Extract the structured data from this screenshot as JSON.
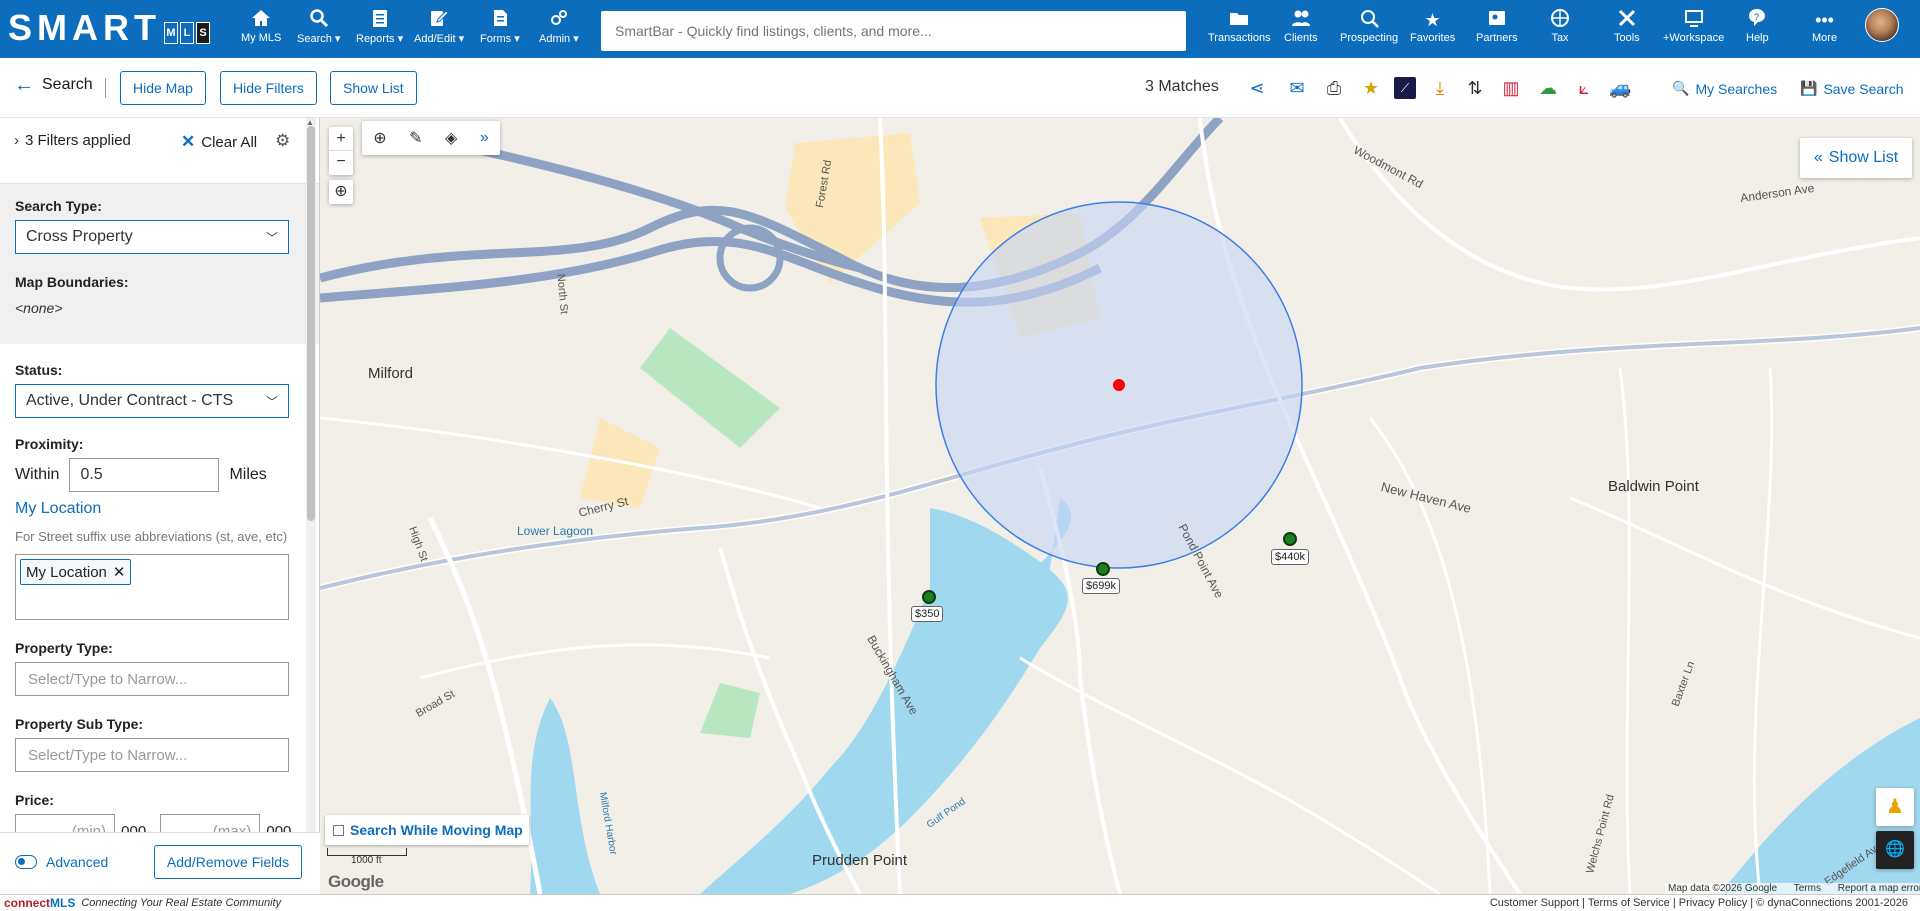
{
  "app": {
    "logo_text": "SMART",
    "logo_badges": [
      "M",
      "L",
      "S"
    ],
    "colors": {
      "brand": "#0d6dbd",
      "pin": "#1e7d1e",
      "marker": "#ff0000",
      "circle_fill": "#c7d6f5",
      "water": "#9fd8ef"
    }
  },
  "topnav": {
    "left_items": [
      {
        "label": "My MLS",
        "icon": "home-icon"
      },
      {
        "label": "Search",
        "icon": "search-icon"
      },
      {
        "label": "Reports",
        "icon": "clipboard-icon"
      },
      {
        "label": "Add/Edit",
        "icon": "edit-icon"
      },
      {
        "label": "Forms",
        "icon": "document-icon"
      },
      {
        "label": "Admin",
        "icon": "gear-network-icon"
      }
    ],
    "smartbar_placeholder": "SmartBar - Quickly find listings, clients, and more...",
    "right_items": [
      {
        "label": "Transactions",
        "icon": "folder-icon"
      },
      {
        "label": "Clients",
        "icon": "people-icon"
      },
      {
        "label": "Prospecting",
        "icon": "magnify-icon"
      },
      {
        "label": "Favorites",
        "icon": "star-icon"
      },
      {
        "label": "Partners",
        "icon": "id-card-icon"
      },
      {
        "label": "Tax",
        "icon": "globe-tax-icon"
      },
      {
        "label": "Tools",
        "icon": "tools-icon"
      },
      {
        "label": "+Workspace",
        "icon": "workspace-icon"
      },
      {
        "label": "Help",
        "icon": "help-icon"
      },
      {
        "label": "More",
        "icon": "more-icon"
      }
    ]
  },
  "toolbar": {
    "back_label": "Search",
    "hide_map": "Hide Map",
    "hide_filters": "Hide Filters",
    "show_list": "Show List",
    "matches": "3 Matches",
    "my_searches": "My Searches",
    "save_search": "Save Search"
  },
  "filters": {
    "applied": "3 Filters applied",
    "clear_all": "Clear All",
    "search_type_label": "Search Type:",
    "search_type_value": "Cross Property",
    "map_boundaries_label": "Map Boundaries:",
    "map_boundaries_value": "<none>",
    "status_label": "Status:",
    "status_value": "Active, Under Contract - CTS",
    "proximity_label": "Proximity:",
    "within": "Within",
    "within_value": "0.5",
    "miles": "Miles",
    "my_location_link": "My Location",
    "hint": "For Street suffix use abbreviations (st, ave, etc)",
    "location_tag": "My Location",
    "property_type_label": "Property Type:",
    "property_type_placeholder": "Select/Type to Narrow...",
    "property_sub_type_label": "Property Sub Type:",
    "property_sub_type_placeholder": "Select/Type to Narrow...",
    "price_label": "Price:",
    "price_min": "(min)",
    "price_max": "(max)",
    "price_suffix": ",000",
    "advanced": "Advanced",
    "add_remove": "Add/Remove Fields"
  },
  "map": {
    "show_list": "Show List",
    "search_while_moving": "Search While Moving Map",
    "listings": [
      {
        "price": "$350"
      },
      {
        "price": "$699k"
      },
      {
        "price": "$440k"
      }
    ],
    "labels": [
      "Milford",
      "Lower Lagoon",
      "Baldwin Point",
      "Prudden Point",
      "New Haven Ave",
      "Pond Point Ave",
      "Buckingham Ave",
      "Cherry St",
      "Woodmont Rd",
      "Anderson Ave",
      "Gulf Pond",
      "Milford Harbor",
      "Forest Rd",
      "North St",
      "High St",
      "Broad St",
      "Baxter Ln",
      "Welchs Point Rd",
      "Edgefield Ave"
    ],
    "scale": "1000 ft",
    "footer": [
      "Map data ©2026 Google",
      "Terms",
      "Report a map error"
    ],
    "google": "Google"
  },
  "footer": {
    "brand_a": "connect",
    "brand_b": "MLS",
    "tagline": "Connecting Your Real Estate Community",
    "links": "Customer Support | Terms of Service | Privacy Policy | © dynaConnections 2001-2026"
  }
}
